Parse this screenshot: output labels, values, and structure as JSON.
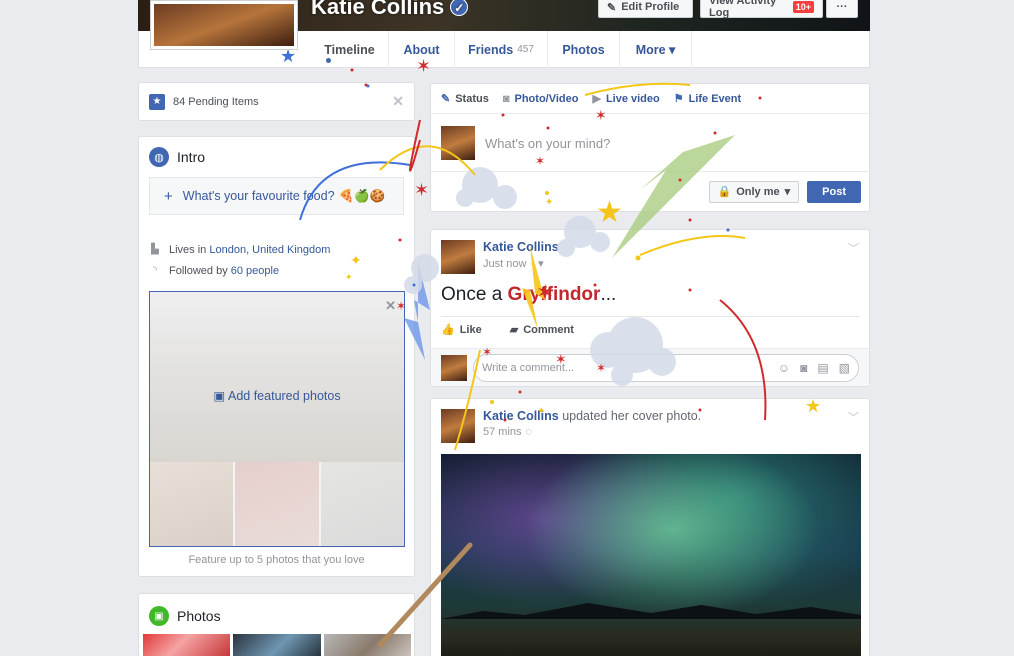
{
  "profile": {
    "name": "Katie Collins",
    "edit_profile_label": "Edit Profile",
    "activity_log_label": "View Activity Log",
    "activity_badge": "10+",
    "more_dots": "···"
  },
  "tabs": [
    {
      "label": "Timeline"
    },
    {
      "label": "About"
    },
    {
      "label": "Friends",
      "count": "457"
    },
    {
      "label": "Photos"
    },
    {
      "label": "More ▾"
    }
  ],
  "pending": {
    "label": "84 Pending Items",
    "close": "✕"
  },
  "intro": {
    "title": "Intro",
    "favourite_prompt": "What's your favourite food?",
    "favourite_emoji": "🍕🍏🍪",
    "lives_prefix": "Lives in ",
    "lives_link": "London, United Kingdom",
    "followed_prefix": "Followed by ",
    "followed_link": "60 people",
    "add_featured": "Add featured photos",
    "feature_caption": "Feature up to 5 photos that you love"
  },
  "photos_section": {
    "title": "Photos"
  },
  "composer": {
    "tabs": [
      "Status",
      "Photo/Video",
      "Live video",
      "Life Event"
    ],
    "placeholder": "What's on your mind?",
    "audience": "Only me",
    "post_label": "Post"
  },
  "post1": {
    "author": "Katie Collins",
    "time": "Just now",
    "text_prefix": "Once a ",
    "text_highlight": "Gryffindor",
    "text_suffix": "...",
    "like_label": "Like",
    "comment_label": "Comment",
    "comment_placeholder": "Write a comment..."
  },
  "post2": {
    "author": "Katie Collins",
    "action": " updated her cover photo.",
    "time": "57 mins"
  },
  "colors": {
    "brand": "#4267b2",
    "link": "#365899",
    "gryffindor_red": "#c1272d",
    "gold": "#f5c518"
  }
}
